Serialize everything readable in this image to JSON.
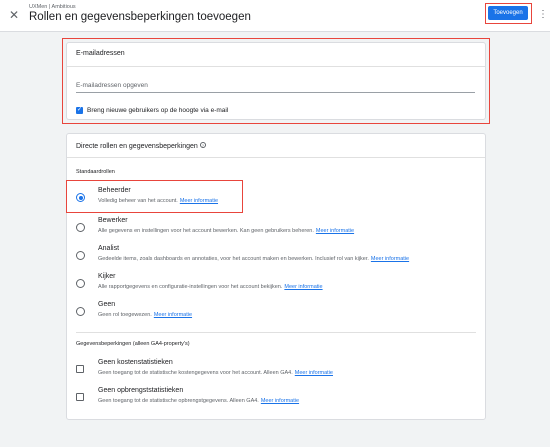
{
  "header": {
    "close_icon": "close-icon",
    "breadcrumb": "UXMen | Ambitious",
    "title": "Rollen en gegevensbeperkingen toevoegen",
    "add_button": "Toevoegen",
    "more_icon": "more-vert-icon"
  },
  "emails": {
    "title": "E-mailadressen",
    "placeholder": "E-mailadressen opgeven",
    "notify_label": "Breng nieuwe gebruikers op de hoogte via e-mail",
    "notify_checked": true
  },
  "roles": {
    "title": "Directe rollen en gegevensbeperkingen",
    "help_icon": "help-circle-icon",
    "standard_label": "Standaardrollen",
    "options": [
      {
        "name": "Beheerder",
        "desc": "Volledig beheer van het account.",
        "link": "Meer informatie",
        "selected": true
      },
      {
        "name": "Bewerker",
        "desc": "Alle gegevens en instellingen voor het account bewerken. Kan geen gebruikers beheren.",
        "link": "Meer informatie",
        "selected": false
      },
      {
        "name": "Analist",
        "desc": "Gedeelde items, zoals dashboards en annotaties, voor het account maken en bewerken. Inclusief rol van kijker.",
        "link": "Meer informatie",
        "selected": false
      },
      {
        "name": "Kijker",
        "desc": "Alle rapportgegevens en configuratie-instellingen voor het account bekijken.",
        "link": "Meer informatie",
        "selected": false
      },
      {
        "name": "Geen",
        "desc": "Geen rol toegewezen.",
        "link": "Meer informatie",
        "selected": false
      }
    ],
    "restrictions_label": "Gegevensbeperkingen (alleen GA4-property's)",
    "restrictions": [
      {
        "name": "Geen kostenstatistieken",
        "desc": "Geen toegang tot de statistische kostengegevens voor het account. Alleen GA4.",
        "link": "Meer informatie",
        "checked": false
      },
      {
        "name": "Geen opbrengststatistieken",
        "desc": "Geen toegang tot de statistische opbrengstgegevens. Alleen GA4.",
        "link": "Meer informatie",
        "checked": false
      }
    ]
  },
  "colors": {
    "accent": "#1a73e8",
    "highlight": "#e8453c",
    "background": "#f1f3f4"
  }
}
